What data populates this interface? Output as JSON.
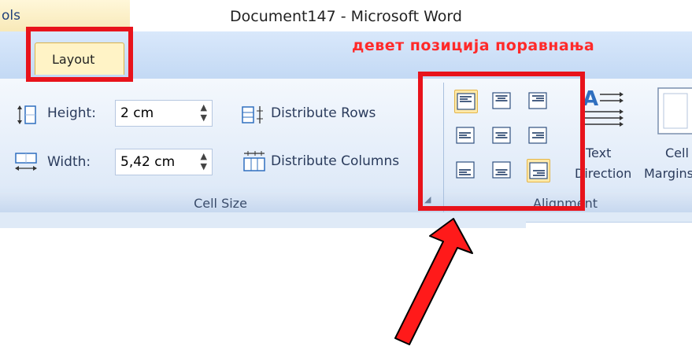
{
  "window": {
    "title": "Document147 - Microsoft Word",
    "tools_tab_label": "ols"
  },
  "tabs": {
    "layout_label": "Layout"
  },
  "annotation": {
    "text": "девет позиција поравнања",
    "color": "#ff2a2a"
  },
  "cell_size": {
    "height_label": "Height:",
    "height_value": "2 cm",
    "width_label": "Width:",
    "width_value": "5,42 cm",
    "distribute_rows": "Distribute Rows",
    "distribute_columns": "Distribute Columns",
    "group_label": "Cell Size"
  },
  "alignment": {
    "group_label": "Alignment",
    "text_direction_line1": "Text",
    "text_direction_line2": "Direction",
    "cell_margins_line1": "Cell",
    "cell_margins_line2": "Margins",
    "buttons": [
      {
        "name": "align-top-left",
        "selected": true
      },
      {
        "name": "align-top-center",
        "selected": false
      },
      {
        "name": "align-top-right",
        "selected": false
      },
      {
        "name": "align-center-left",
        "selected": false
      },
      {
        "name": "align-center",
        "selected": false
      },
      {
        "name": "align-center-right",
        "selected": false
      },
      {
        "name": "align-bottom-left",
        "selected": false
      },
      {
        "name": "align-bottom-center",
        "selected": false
      },
      {
        "name": "align-bottom-right",
        "selected": true
      }
    ]
  },
  "colors": {
    "highlight_red": "#e8131b",
    "ribbon_blue": "#c3d9f4",
    "selected_gold": "#ffe9a8"
  }
}
